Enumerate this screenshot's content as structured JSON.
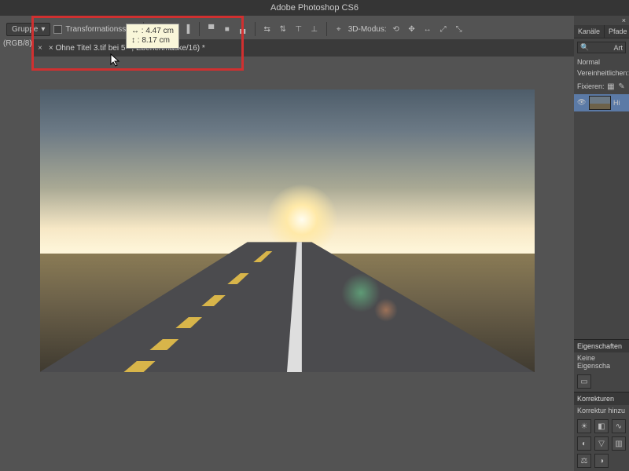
{
  "app": {
    "title": "Adobe Photoshop CS6"
  },
  "options": {
    "group_label": "Gruppe",
    "rgb_label": "(RGB/8)",
    "transform_label": "Transformationsstrg.",
    "mode3d_label": "3D-Modus:"
  },
  "tooltip": {
    "line1": "↔ : 4.47 cm",
    "line2": "↕ : 8.17 cm"
  },
  "tabs": {
    "doc1_prefix": "×  Ohne Titel 3.tif bei 5",
    "doc1_suffix": ", Ebenenmaske/16) *"
  },
  "panel_layers": {
    "tab1": "Kanäle",
    "tab2": "Pfade",
    "filter_kind": "Art",
    "blend_mode": "Normal",
    "unify": "Vereinheitlichen:",
    "lock": "Fixieren:",
    "layer_name": "Hi"
  },
  "panel_props": {
    "heading": "Eigenschaften",
    "body": "Keine Eigenscha"
  },
  "panel_adjust": {
    "heading": "Korrekturen",
    "body": "Korrektur hinzu"
  },
  "icons": {
    "align": [
      "align-left",
      "align-hcenter",
      "align-right",
      "align-top",
      "align-vcenter",
      "align-bottom"
    ],
    "dist": [
      "dist-h",
      "dist-v",
      "dist-top",
      "dist-bottom"
    ],
    "d3": [
      "orbit-icon",
      "pan-icon",
      "zoom-icon",
      "rotate-icon",
      "light-icon"
    ]
  }
}
